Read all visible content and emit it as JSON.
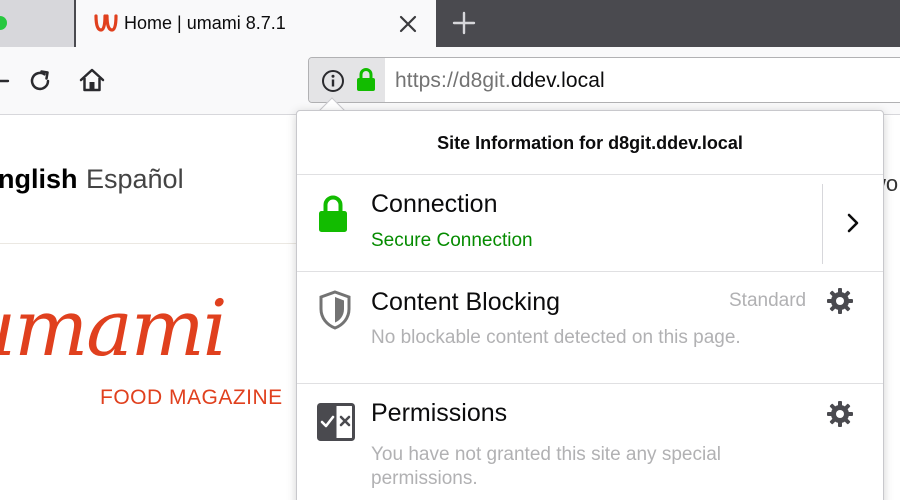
{
  "browser": {
    "tab": {
      "title": "Home | umami 8.7.1",
      "favicon": "umami-favicon-icon",
      "close_icon": "close-icon"
    },
    "new_tab_icon": "plus-icon",
    "toolbar": {
      "reload_icon": "reload-icon",
      "home_icon": "home-icon"
    },
    "urlbar": {
      "info_icon": "info-icon",
      "lock_icon": "lock-icon",
      "url_prefix": "https://d8git.",
      "url_host": "ddev.local"
    }
  },
  "page": {
    "languages": [
      "English",
      "Español"
    ],
    "right_peek": "wo",
    "logo": {
      "wordmark": "umami",
      "tagline": "FOOD MAGAZINE"
    }
  },
  "site_info_panel": {
    "title": "Site Information for d8git.ddev.local",
    "connection": {
      "title": "Connection",
      "status": "Secure Connection",
      "icon": "lock-icon",
      "expand_icon": "chevron-right-icon"
    },
    "content_blocking": {
      "title": "Content Blocking",
      "level": "Standard",
      "description": "No blockable content detected on this page.",
      "icon": "shield-icon",
      "settings_icon": "gear-icon"
    },
    "permissions": {
      "title": "Permissions",
      "description": "You have not granted this site any special permissions.",
      "icon": "permissions-icon",
      "settings_icon": "gear-icon"
    }
  },
  "colors": {
    "secure_green": "#058b00",
    "lock_green": "#12bc00",
    "brand_red": "#e0401e",
    "tabstrip_dark": "#4a4a4f",
    "muted_text": "#b1b1b3"
  }
}
